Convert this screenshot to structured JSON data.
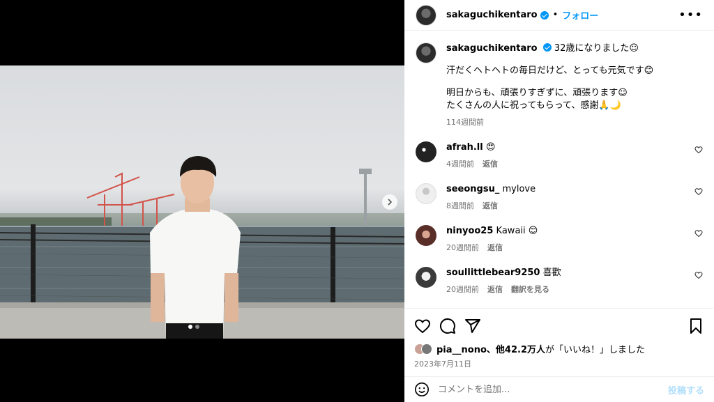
{
  "header": {
    "username": "sakaguchikentaro",
    "separator": "•",
    "follow_label": "フォロー",
    "more_icon": "more-icon"
  },
  "caption": {
    "username": "sakaguchikentaro",
    "line1": "32歳になりました☺",
    "line2": "汗だくヘトヘトの毎日だけど、とっても元気です😊",
    "line3": "明日からも、頑張りすぎずに、頑張ります☺",
    "line4": "たくさんの人に祝ってもらって、感謝🙏🌙",
    "time": "114週間前"
  },
  "comments": [
    {
      "username": "afrah.ll",
      "text": "😍",
      "time": "4週間前",
      "reply": "返信",
      "translate": ""
    },
    {
      "username": "seeongsu_",
      "text": "mylove",
      "time": "8週間前",
      "reply": "返信",
      "translate": ""
    },
    {
      "username": "ninyoo25",
      "text": "Kawaii 😊",
      "time": "20週間前",
      "reply": "返信",
      "translate": ""
    },
    {
      "username": "soullittlebear9250",
      "text": "喜歡",
      "time": "20週間前",
      "reply": "返信",
      "translate": "翻訳を見る"
    }
  ],
  "likes": {
    "first": "pia__nono",
    "mid": "、他",
    "count": "42.2万人",
    "tail": "が「いいね！」しました"
  },
  "date": "2023年7月11日",
  "add_comment": {
    "placeholder": "コメントを追加...",
    "post_label": "投稿する"
  },
  "colors": {
    "accent": "#0095f6",
    "muted": "#737373",
    "post_disabled": "#b2dffc"
  }
}
